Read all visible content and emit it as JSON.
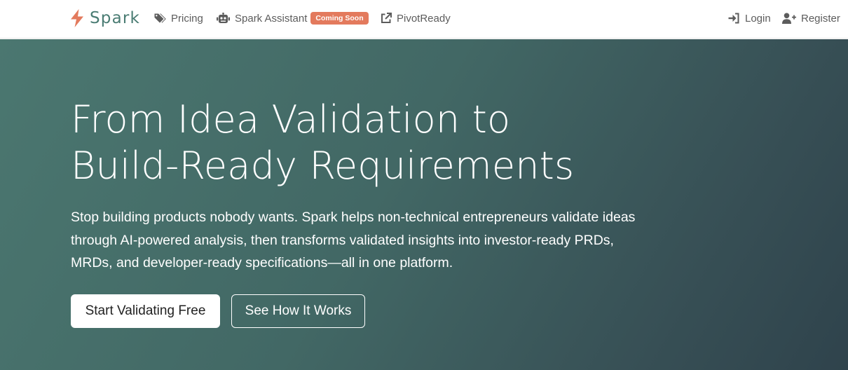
{
  "colors": {
    "brand": "#4a7c73",
    "brand_icon": "#e37a5d",
    "badge_bg": "#e37a5d",
    "nav_text": "#5c5c5c",
    "hero_gradient_start": "#4b7770",
    "hero_gradient_end": "#2f434c"
  },
  "navbar": {
    "brand": {
      "name": "Spark",
      "icon": "bolt-icon"
    },
    "links": [
      {
        "label": "Pricing",
        "icon": "tags-icon"
      },
      {
        "label": "Spark Assistant",
        "icon": "robot-icon",
        "badge": "Coming Soon"
      },
      {
        "label": "PivotReady",
        "icon": "external-link-icon"
      }
    ],
    "right": [
      {
        "label": "Login",
        "icon": "sign-in-icon"
      },
      {
        "label": "Register",
        "icon": "user-plus-icon"
      }
    ]
  },
  "hero": {
    "title_line1": "From Idea Validation to",
    "title_line2": "Build-Ready Requirements",
    "description": "Stop building products nobody wants. Spark helps non-technical entrepreneurs validate ideas through AI-powered analysis, then transforms validated insights into investor-ready PRDs, MRDs, and developer-ready specifications—all in one platform.",
    "primary_cta": "Start Validating Free",
    "secondary_cta": "See How It Works"
  }
}
